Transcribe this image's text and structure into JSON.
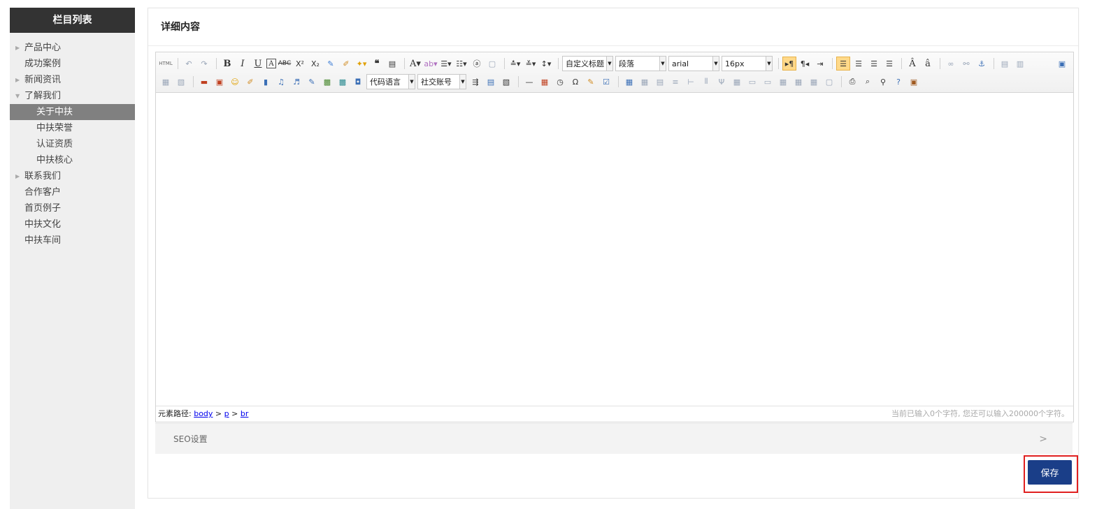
{
  "sidebar": {
    "title": "栏目列表",
    "items": [
      {
        "label": "产品中心",
        "level": 1,
        "expandable": true
      },
      {
        "label": "成功案例",
        "level": 1
      },
      {
        "label": "新闻资讯",
        "level": 1,
        "expandable": true
      },
      {
        "label": "了解我们",
        "level": 1,
        "expanded": true
      },
      {
        "label": "关于中扶",
        "level": 2,
        "active": true
      },
      {
        "label": "中扶荣誉",
        "level": 2
      },
      {
        "label": "认证资质",
        "level": 2
      },
      {
        "label": "中扶核心",
        "level": 2
      },
      {
        "label": "联系我们",
        "level": 1,
        "expandable": true
      },
      {
        "label": "合作客户",
        "level": 1
      },
      {
        "label": "首页例子",
        "level": 1
      },
      {
        "label": "中扶文化",
        "level": 1
      },
      {
        "label": "中扶车间",
        "level": 1
      }
    ]
  },
  "main": {
    "title": "详细内容"
  },
  "editor": {
    "toolbar": {
      "html_label": "HTML",
      "heading_select": "自定义标题",
      "paragraph_select": "段落",
      "font_select": "arial",
      "size_select": "16px",
      "code_lang_select": "代码语言",
      "social_select": "社交账号"
    },
    "status": {
      "path_label": "元素路径:",
      "path": [
        "body",
        "p",
        "br"
      ],
      "path_sep": " > ",
      "char_count": "当前已输入0个字符, 您还可以输入200000个字符。"
    }
  },
  "seo": {
    "label": "SEO设置",
    "chevron": ">"
  },
  "save": {
    "label": "保存"
  },
  "colors": {
    "sidebar_header": "#333333",
    "active_item": "#808080",
    "save_button": "#1a3e88",
    "highlight_outline": "#e02020"
  }
}
